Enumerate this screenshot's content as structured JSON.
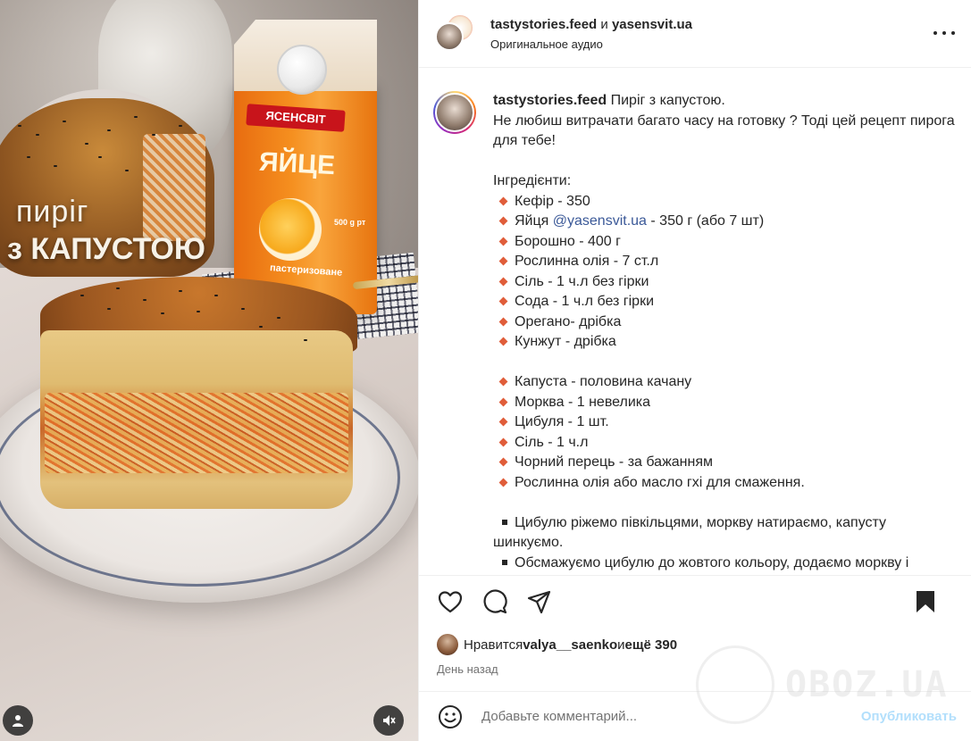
{
  "media": {
    "overlay_line1": "пиріг",
    "overlay_line2": "з КАПУСТОЮ",
    "carton_brand": "ЯСЕНСВІТ",
    "carton_product": "ЯЙЦЕ",
    "carton_volume": "500 g рт",
    "carton_note": "пастеризоване",
    "left_button_icon": "user-icon",
    "right_button_icon": "muted-speaker-icon"
  },
  "header": {
    "user1": "tastystories.feed",
    "conj": " и ",
    "user2": "yasensvit.ua",
    "audio": "Оригинальное аудио",
    "more_icon": "more-horizontal-icon"
  },
  "caption": {
    "username": "tastystories.feed",
    "title": " Пиріг з капустою.",
    "intro": "Не любиш витрачати багато часу на готовку ? Тоді цей рецепт пирога для тебе!",
    "ingredients_header": "Інгредієнти:",
    "group1": [
      {
        "text": "Кефір - 350"
      },
      {
        "pre": "Яйця ",
        "mention": "@yasensvit.ua",
        "post": " - 350 г (або 7 шт)"
      },
      {
        "text": "Борошно - 400 г"
      },
      {
        "text": "Рослинна олія - 7 ст.л"
      },
      {
        "text": "Сіль - 1 ч.л без гірки"
      },
      {
        "text": "Сода - 1 ч.л без гірки"
      },
      {
        "text": "Орегано- дрібка"
      },
      {
        "text": "Кунжут - дрібка"
      }
    ],
    "group2": [
      "Капуста - половина качану",
      "Морква - 1 невелика",
      "Цибуля - 1 шт.",
      "Сіль - 1 ч.л",
      "Чорний перець - за бажанням",
      "Рослинна олія або масло гхі для смаження."
    ],
    "steps": [
      "Цибулю ріжемо півкільцями, моркву натираємо, капусту шинкуємо.",
      "Обсмажуємо цибулю до жовтого кольору, додаємо моркву і"
    ]
  },
  "actions": {
    "like_icon": "heart-icon",
    "comment_icon": "comment-icon",
    "share_icon": "share-icon",
    "save_icon": "bookmark-icon"
  },
  "likes": {
    "prefix": "Нравится ",
    "user": "valya__saenko",
    "middle": " и ",
    "rest": "ещё 390"
  },
  "time": "День назад",
  "comment": {
    "placeholder": "Добавьте комментарий...",
    "post_label": "Опубликовать",
    "emoji_icon": "emoji-icon"
  },
  "watermark": "OBOZ.UA",
  "colors": {
    "mention": "#3b5998",
    "post_disabled": "#b2dffc",
    "bullet": "#e05d3a"
  }
}
